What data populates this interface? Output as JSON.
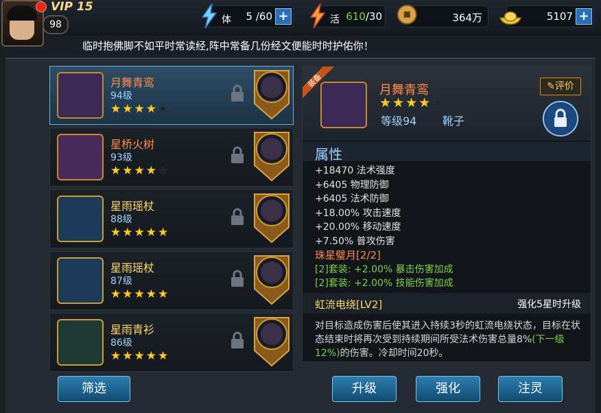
{
  "player": {
    "vip": "VIP 15",
    "level": "98"
  },
  "resources": {
    "stamina": {
      "label": "体",
      "value": "5 /60"
    },
    "vitality": {
      "label": "活",
      "current": "610",
      "max": "/30"
    },
    "gold": {
      "value": "364万"
    },
    "ingots": {
      "value": "5107"
    }
  },
  "ticker": "临时抱佛脚不如平时常读经,阵中常备几份经文便能时时护佑你！",
  "items": [
    {
      "name": "月舞青鸾",
      "level": "94级",
      "stars": 4,
      "name_color": "#ff8a4a"
    },
    {
      "name": "星桥火树",
      "level": "93级",
      "stars": 4,
      "name_color": "#ff8a4a"
    },
    {
      "name": "星雨瑶杖",
      "level": "88级",
      "stars": 5,
      "name_color": "#ffd86a"
    },
    {
      "name": "星雨瑶杖",
      "level": "87级",
      "stars": 5,
      "name_color": "#ffd86a"
    },
    {
      "name": "星雨青衫",
      "level": "86级",
      "stars": 5,
      "name_color": "#ffd86a"
    }
  ],
  "filter_button": "筛选",
  "detail": {
    "ribbon": "装备",
    "name": "月舞青鸾",
    "stars": 4,
    "level": "等级94",
    "type": "靴子",
    "rate_button": "评价",
    "attr_title": "属性",
    "attrs": [
      "+18470 法术强度",
      "+6405 物理防御",
      "+6405 法术防御",
      "+18.00% 攻击速度",
      "+20.00% 移动速度",
      "+7.50% 普攻伤害"
    ],
    "set_name": "珠星璧月[2/2]",
    "set_bonus": [
      "[2]套装: +2.00% 暴击伤害加成",
      "[2]套装: +2.00% 技能伤害加成"
    ],
    "skill_name": "虹流电绕[LV2]",
    "skill_note": "强化5星时升级",
    "skill_desc_a": "对目标造成伤害后使其进入持续3秒的虹流电绕状态，目标在状态结束时将再次受到持续期间所受法术伤害总量8%",
    "skill_desc_next": "(下一级12%)",
    "skill_desc_b": "的伤害。冷却时间20秒。"
  },
  "actions": {
    "upgrade": "升级",
    "enhance": "强化",
    "infuse": "注灵"
  }
}
